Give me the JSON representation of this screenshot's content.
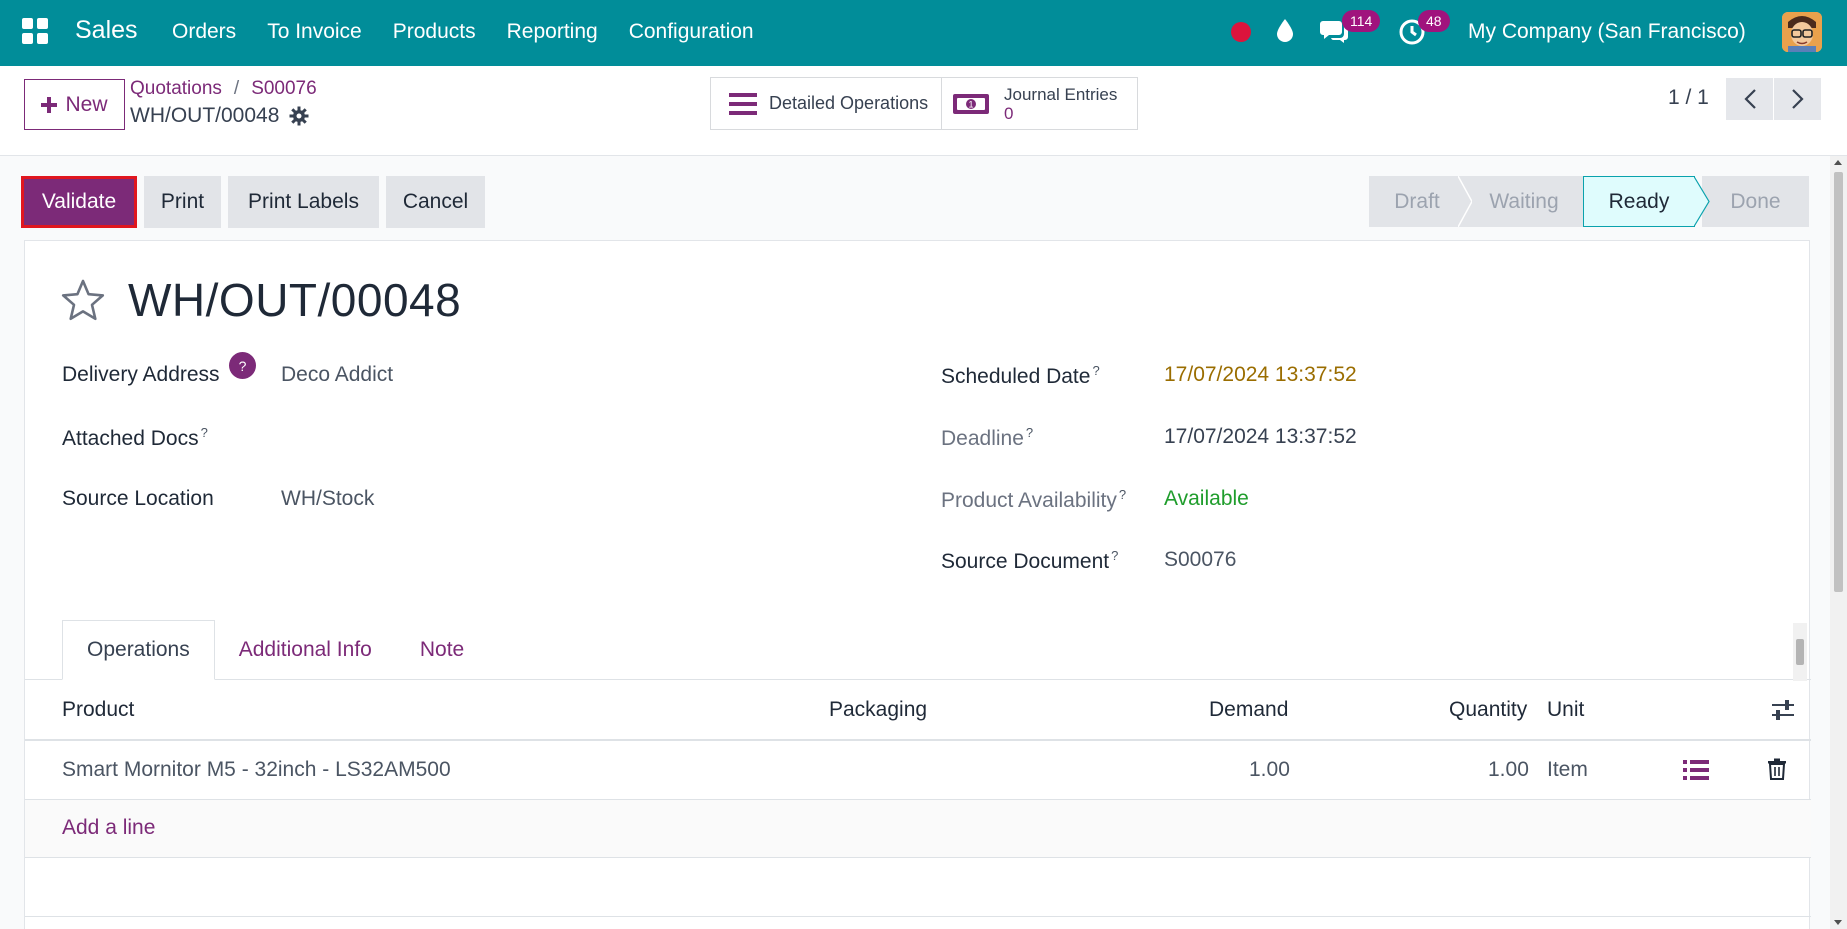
{
  "app": {
    "name": "Sales"
  },
  "menu": [
    "Orders",
    "To Invoice",
    "Products",
    "Reporting",
    "Configuration"
  ],
  "systray": {
    "chat_count": "114",
    "activity_count": "48",
    "company": "My Company (San Francisco)"
  },
  "control": {
    "new_label": "New",
    "breadcrumbs": [
      "Quotations",
      "S00076"
    ],
    "record": "WH/OUT/00048",
    "smart_buttons": {
      "ops_label": "Detailed Operations",
      "je_label": "Journal Entries",
      "je_count": "0"
    },
    "pager": "1 / 1"
  },
  "actions": {
    "validate": "Validate",
    "print": "Print",
    "print_labels": "Print Labels",
    "cancel": "Cancel"
  },
  "status": {
    "stages": [
      "Draft",
      "Waiting",
      "Ready",
      "Done"
    ],
    "current": "Ready"
  },
  "form": {
    "title": "WH/OUT/00048",
    "help_mark": "?",
    "left": {
      "delivery_address_label": "Delivery Address",
      "delivery_address": "Deco Addict",
      "attached_docs_label": "Attached Docs",
      "source_location_label": "Source Location",
      "source_location": "WH/Stock"
    },
    "right": {
      "scheduled_date_label": "Scheduled Date",
      "scheduled_date": "17/07/2024 13:37:52",
      "deadline_label": "Deadline",
      "deadline": "17/07/2024 13:37:52",
      "availability_label": "Product Availability",
      "availability": "Available",
      "source_document_label": "Source Document",
      "source_document": "S00076"
    },
    "tabs": [
      "Operations",
      "Additional Info",
      "Note"
    ],
    "columns": {
      "product": "Product",
      "packaging": "Packaging",
      "demand": "Demand",
      "quantity": "Quantity",
      "unit": "Unit"
    },
    "lines": [
      {
        "product": "Smart Mornitor M5 - 32inch - LS32AM500",
        "packaging": "",
        "demand": "1.00",
        "quantity": "1.00",
        "unit": "Item"
      }
    ],
    "add_line": "Add a line"
  },
  "colors": {
    "topbar": "#018d99",
    "primary": "#7c2a78",
    "date_warning": "#9a6d00",
    "available": "#1f9d2c",
    "ready_stage": "#dffcfd"
  }
}
